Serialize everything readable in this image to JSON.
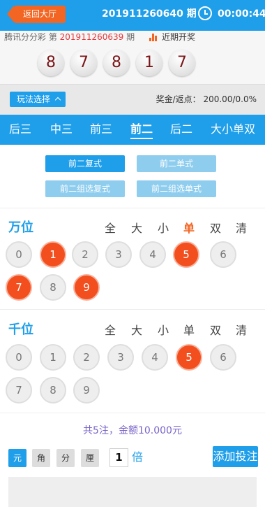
{
  "header": {
    "back_label": "返回大厅",
    "period": "201911260640 期",
    "timer": "00:00:44"
  },
  "last_draw": {
    "game": "腾讯分分彩 第",
    "period_no": "201911260639",
    "period_suffix": "期",
    "recent_label": "近期开奖",
    "balls": [
      "8",
      "7",
      "8",
      "1",
      "7"
    ]
  },
  "play": {
    "select_label": "玩法选择",
    "bonus": "奖金/返点： 200.00/0.0%"
  },
  "tabs": [
    "后三",
    "中三",
    "前三",
    "前二",
    "后二",
    "大小单双"
  ],
  "active_tab": "前二",
  "subtabs": [
    "前二复式",
    "前二单式",
    "前二组选复式",
    "前二组选单式"
  ],
  "active_subtab": "前二复式",
  "filters": [
    "全",
    "大",
    "小",
    "单",
    "双",
    "清"
  ],
  "positions": [
    {
      "label": "万位",
      "highlight_filter": "单",
      "digits": [
        "0",
        "1",
        "2",
        "3",
        "4",
        "5",
        "6",
        "7",
        "8",
        "9"
      ],
      "selected": [
        "1",
        "5",
        "7",
        "9"
      ]
    },
    {
      "label": "千位",
      "highlight_filter": "",
      "digits": [
        "0",
        "1",
        "2",
        "3",
        "4",
        "5",
        "6",
        "7",
        "8",
        "9"
      ],
      "selected": [
        "5"
      ]
    }
  ],
  "summary": "共5注，金额10.000元",
  "units": [
    "元",
    "角",
    "分",
    "厘"
  ],
  "active_unit": "元",
  "multiplier": "1",
  "multiplier_label": "倍",
  "add_button": "添加投注",
  "colors": {
    "primary_blue": "#1f9ee9",
    "accent_orange": "#f26522",
    "selected_ball": "#f24e1e"
  }
}
